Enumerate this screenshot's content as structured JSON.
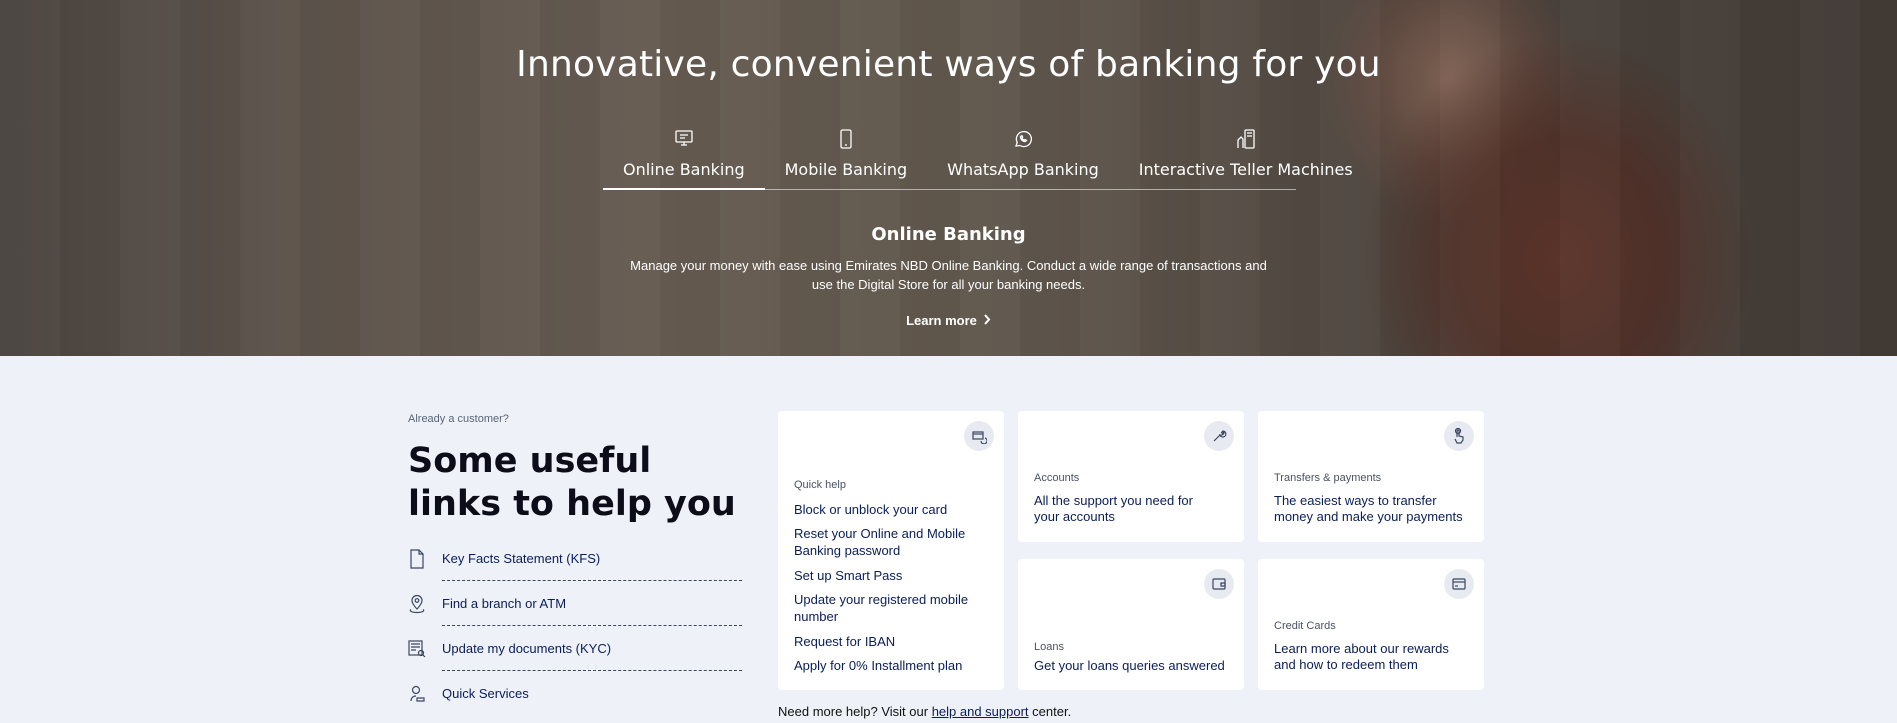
{
  "hero": {
    "title": "Innovative, convenient ways of banking for you",
    "tabs": [
      {
        "label": "Online Banking",
        "icon": "online-banking-icon",
        "active": true
      },
      {
        "label": "Mobile Banking",
        "icon": "mobile-phone-icon",
        "active": false
      },
      {
        "label": "WhatsApp Banking",
        "icon": "whatsapp-icon",
        "active": false
      },
      {
        "label": "Interactive Teller Machines",
        "icon": "teller-machine-icon",
        "active": false
      }
    ],
    "panel_title": "Online Banking",
    "panel_desc": "Manage your money with ease using Emirates NBD Online Banking. Conduct a wide range of transactions and use the Digital Store for all your banking needs.",
    "learn_more": "Learn more"
  },
  "links": {
    "eyebrow": "Already a customer?",
    "title": "Some useful links to help you",
    "items": [
      {
        "label": "Key Facts Statement (KFS)",
        "icon": "document-icon"
      },
      {
        "label": "Find a branch or ATM",
        "icon": "location-pin-icon"
      },
      {
        "label": "Update my documents (KYC)",
        "icon": "document-search-icon"
      },
      {
        "label": "Quick Services",
        "icon": "quick-services-icon"
      }
    ]
  },
  "cards": {
    "quick_help": {
      "title": "Quick help",
      "icon": "card-refresh-icon",
      "links": [
        "Block or unblock your card",
        "Reset your Online and Mobile Banking password",
        "Set up Smart Pass",
        "Update your registered mobile number",
        "Request for IBAN",
        "Apply for 0% Installment plan"
      ]
    },
    "accounts": {
      "title": "Accounts",
      "desc": "All the support you need for your accounts",
      "icon": "wrench-icon"
    },
    "transfers": {
      "title": "Transfers & payments",
      "desc": "The easiest ways to transfer money and make your payments",
      "icon": "hand-tap-icon"
    },
    "loans": {
      "title": "Loans",
      "desc": "Get your loans queries answered",
      "icon": "wallet-icon"
    },
    "credit_cards": {
      "title": "Credit Cards",
      "desc": "Learn more about our rewards and how to redeem them",
      "icon": "credit-card-icon"
    }
  },
  "help": {
    "prefix": "Need more help? Visit our ",
    "link": "help and support",
    "suffix": " center."
  }
}
